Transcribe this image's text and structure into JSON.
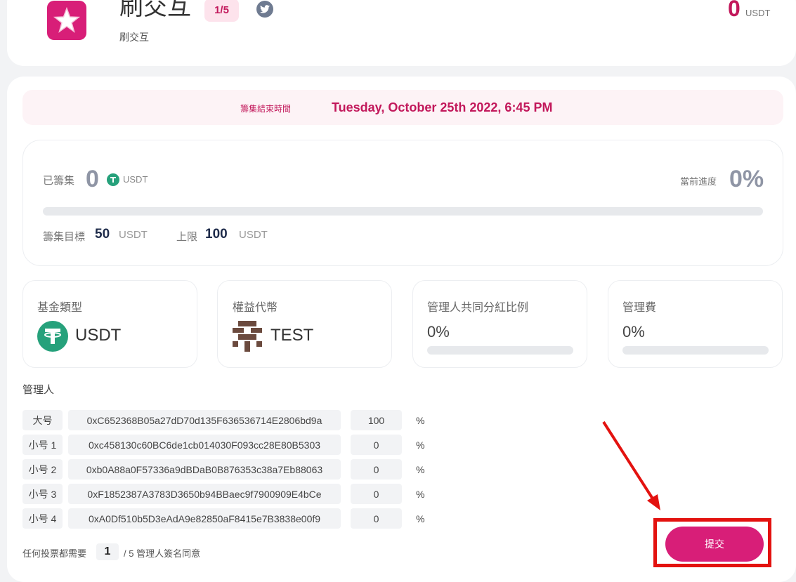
{
  "header": {
    "title": "刷交互",
    "subtitle": "刷交互",
    "badge": "1/5",
    "balance_value": "0",
    "balance_unit": "USDT",
    "logo_icon": "star-icon",
    "social_icon": "twitter-icon"
  },
  "deadline": {
    "label": "籌集結束時間",
    "value": "Tuesday, October 25th 2022, 6:45 PM"
  },
  "progress": {
    "raised_label": "已籌集",
    "raised_value": "0",
    "raised_unit": "USDT",
    "progress_label": "當前進度",
    "progress_value": "0%",
    "progress_fraction": 0,
    "goal_label": "籌集目標",
    "goal_value": "50",
    "goal_unit": "USDT",
    "cap_label": "上限",
    "cap_value": "100",
    "cap_unit": "USDT"
  },
  "info": {
    "fund_type_label": "基金類型",
    "fund_type_value": "USDT",
    "equity_token_label": "權益代幣",
    "equity_token_value": "TEST",
    "manager_share_label": "管理人共同分紅比例",
    "manager_share_value": "0%",
    "manager_fee_label": "管理費",
    "manager_fee_value": "0%"
  },
  "managers": {
    "title": "管理人",
    "percent_sign": "%",
    "rows": [
      {
        "role": "大号",
        "address": "0xC652368B05a27dD70d135F636536714E2806bd9a",
        "share": "100"
      },
      {
        "role": "小号 1",
        "address": "0xc458130c60BC6de1cb014030F093cc28E80B5303",
        "share": "0"
      },
      {
        "role": "小号 2",
        "address": "0xb0A88a0F57336a9dBDaB0B876353c38a7Eb88063",
        "share": "0"
      },
      {
        "role": "小号 3",
        "address": "0xF1852387A3783D3650b94BBaec9f7900909E4bCe",
        "share": "0"
      },
      {
        "role": "小号 4",
        "address": "0xA0Df510b5D3eAdA9e82850aF8415e7B3838e00f9",
        "share": "0"
      }
    ]
  },
  "vote": {
    "prefix": "任何投票都需要",
    "value": "1",
    "suffix": "/ 5 管理人簽名同意"
  },
  "submit_label": "提交",
  "colors": {
    "accent": "#d81e78",
    "tether": "#26a17b",
    "highlight_red": "#e3120f"
  }
}
